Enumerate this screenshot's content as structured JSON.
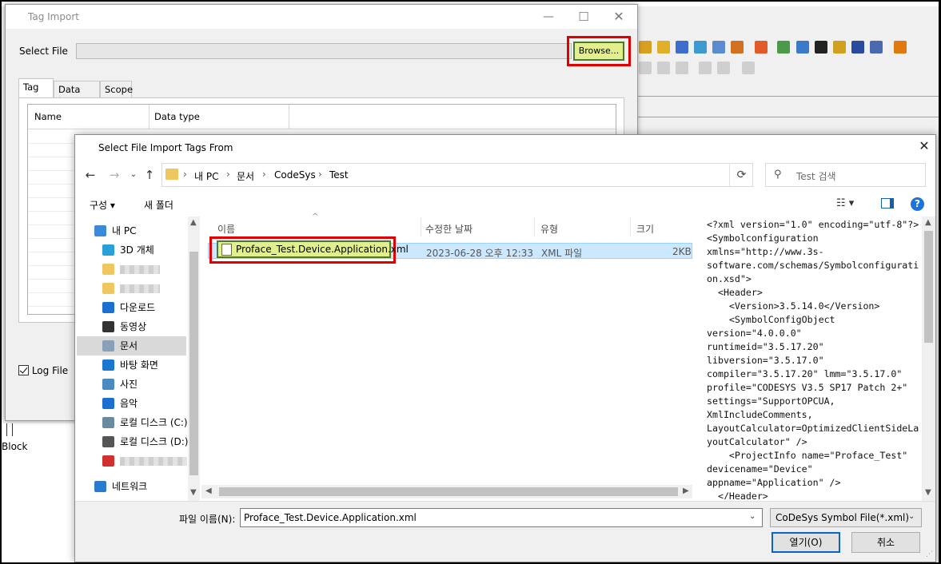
{
  "background": {
    "block_label": "Block",
    "toolbar_icon_colors": [
      "#d8a020",
      "#e0b02a",
      "#3c6ecc",
      "#3c9ad0",
      "#5a8ad0",
      "#d07020",
      "#e05a2a",
      "#4a9a4a",
      "#3a7ac8",
      "#222222",
      "#d0a020",
      "#2a4aa0",
      "#4a6ab0",
      "#e07a10"
    ]
  },
  "tag_import": {
    "title": "Tag Import",
    "select_file_label": "Select File",
    "browse_label": "Browse...",
    "tabs": [
      {
        "label": "Tag"
      },
      {
        "label": "Data type"
      },
      {
        "label": "Scope"
      }
    ],
    "columns": [
      "Name",
      "Data type"
    ],
    "log_file_label": "Log File",
    "log_file_checked": true
  },
  "file_dialog": {
    "title": "Select File Import Tags From",
    "breadcrumb": [
      "내 PC",
      "문서",
      "CodeSys",
      "Test"
    ],
    "search_placeholder": "Test 검색",
    "organize_label": "구성 ▾",
    "new_folder_label": "새 폴더",
    "help_label": "?",
    "nav": [
      {
        "label": "내 PC",
        "icon": "pc-icon",
        "color": "#3a8ad8"
      },
      {
        "label": "3D 개체",
        "icon": "3d-objects-icon",
        "color": "#2aa0d8"
      },
      {
        "label": "",
        "icon": "folder-icon",
        "color": "#f0c75e"
      },
      {
        "label": "",
        "icon": "folder-icon",
        "color": "#f0c75e"
      },
      {
        "label": "다운로드",
        "icon": "download-icon",
        "color": "#1c6fd0"
      },
      {
        "label": "동영상",
        "icon": "video-icon",
        "color": "#333333"
      },
      {
        "label": "문서",
        "icon": "document-icon",
        "color": "#8aa0b8"
      },
      {
        "label": "바탕 화면",
        "icon": "desktop-icon",
        "color": "#1a78d0"
      },
      {
        "label": "사진",
        "icon": "picture-icon",
        "color": "#4a8ac0"
      },
      {
        "label": "음악",
        "icon": "music-icon",
        "color": "#1c6fd0"
      },
      {
        "label": "로컬 디스크 (C:)",
        "icon": "drive-icon",
        "color": "#6a8aa0"
      },
      {
        "label": "로컬 디스크 (D:)",
        "icon": "drive-icon",
        "color": "#555555"
      },
      {
        "label": "",
        "icon": "network-drive-icon",
        "color": "#d03030"
      },
      {
        "label": "네트워크",
        "icon": "network-icon",
        "color": "#2a7ad0"
      }
    ],
    "list_columns": [
      "이름",
      "수정한 날짜",
      "유형",
      "크기"
    ],
    "files": [
      {
        "name": "Proface_Test.Device.Application.xml",
        "modified": "2023-06-28 오후 12:33",
        "type": "XML 파일",
        "size": "2KB"
      }
    ],
    "preview_text": "<?xml version=\"1.0\" encoding=\"utf-8\"?>\n<Symbolconfiguration\nxmlns=\"http://www.3s-\nsoftware.com/schemas/Symbolconfigurati\non.xsd\">\n  <Header>\n    <Version>3.5.14.0</Version>\n    <SymbolConfigObject\nversion=\"4.0.0.0\"\nruntimeid=\"3.5.17.20\"\nlibversion=\"3.5.17.0\"\ncompiler=\"3.5.17.20\" lmm=\"3.5.17.0\"\nprofile=\"CODESYS V3.5 SP17 Patch 2+\"\nsettings=\"SupportOPCUA,\nXmlIncludeComments,\nLayoutCalculator=OptimizedClientSideLa\nyoutCalculator\" />\n    <ProjectInfo name=\"Proface_Test\"\ndevicename=\"Device\"\nappname=\"Application\" />\n  </Header>",
    "filename_label": "파일 이름(N):",
    "filename_value": "Proface_Test.Device.Application.xml",
    "filetype_value": "CoDeSys Symbol File(*.xml)",
    "open_label": "열기(O)",
    "cancel_label": "취소",
    "accent_color": "#0a64c4",
    "highlight_color": "#e00000"
  }
}
